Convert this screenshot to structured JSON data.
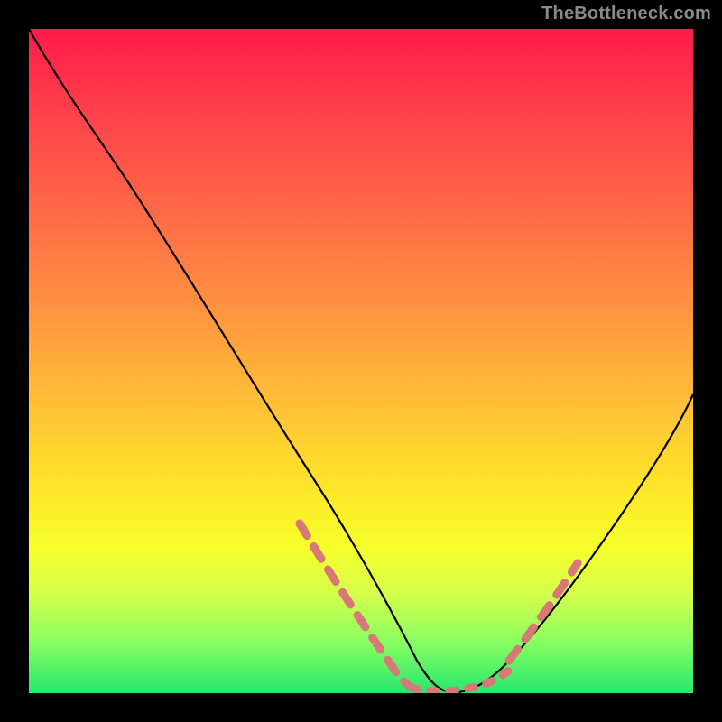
{
  "watermark": "TheBottleneck.com",
  "chart_data": {
    "type": "line",
    "title": "",
    "xlabel": "",
    "ylabel": "",
    "xlim": [
      0,
      100
    ],
    "ylim": [
      0,
      100
    ],
    "grid": false,
    "legend": false,
    "series": [
      {
        "name": "curve",
        "stroke": "#000000",
        "x": [
          0,
          5,
          10,
          15,
          20,
          25,
          30,
          35,
          40,
          45,
          50,
          55,
          57,
          60,
          65,
          70,
          75,
          80,
          85,
          90,
          95,
          100
        ],
        "y": [
          100,
          92,
          83,
          74,
          64,
          54,
          44,
          34,
          25,
          16,
          9,
          3,
          1,
          0,
          0,
          2,
          6,
          12,
          20,
          29,
          38,
          48
        ]
      },
      {
        "name": "left-highlight-dashes",
        "stroke": "#d56a6a",
        "style": "dashed",
        "x": [
          40,
          42,
          44,
          46,
          48,
          50,
          52,
          54,
          56
        ],
        "y": [
          25,
          21,
          18,
          15,
          12,
          9,
          6,
          4,
          2
        ]
      },
      {
        "name": "right-highlight-dashes",
        "stroke": "#d56a6a",
        "style": "dashed",
        "x": [
          72,
          74,
          76,
          78,
          80,
          82
        ],
        "y": [
          4,
          6,
          8,
          10,
          13,
          15
        ]
      },
      {
        "name": "bottom-dots",
        "stroke": "#d56a6a",
        "style": "dotted",
        "x": [
          57,
          59,
          61,
          63,
          65,
          67,
          69,
          71
        ],
        "y": [
          1,
          0.5,
          0,
          0,
          0,
          0.5,
          1.5,
          3
        ]
      }
    ]
  }
}
